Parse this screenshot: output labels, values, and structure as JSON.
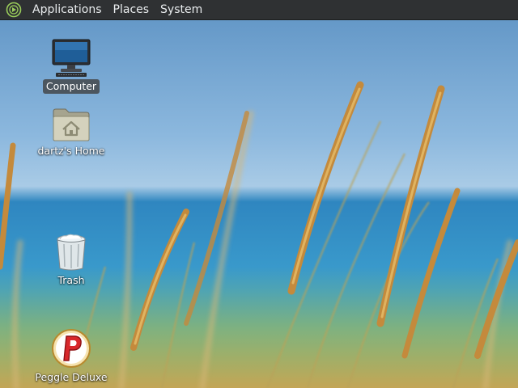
{
  "panel": {
    "logo_icon": "distro-logo-icon",
    "menus": [
      "Applications",
      "Places",
      "System"
    ]
  },
  "desktop": {
    "icons": [
      {
        "label": "Computer",
        "icon": "computer-icon",
        "selected": true
      },
      {
        "label": "dartz's Home",
        "icon": "home-folder-icon",
        "selected": false
      },
      {
        "label": "Trash",
        "icon": "trash-icon",
        "selected": false
      },
      {
        "label": "Peggle Deluxe",
        "icon": "peggle-icon",
        "selected": false
      }
    ]
  },
  "colors": {
    "panel_bg": "#2f3133",
    "panel_text": "#e9ecee",
    "sky": "#7fb0dc",
    "sea": "#2f8fc4",
    "grass": "#c99a4a"
  }
}
